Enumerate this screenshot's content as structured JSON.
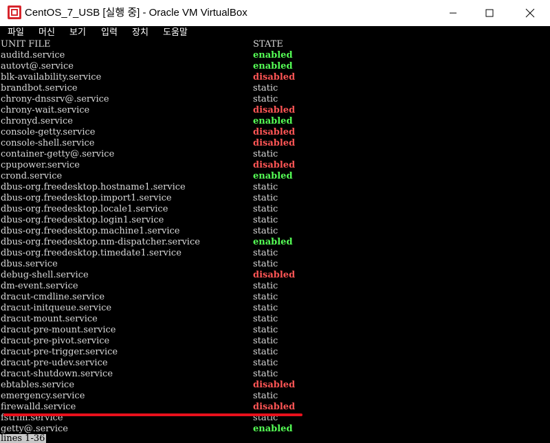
{
  "window": {
    "title": "CentOS_7_USB [실행 중] - Oracle VM VirtualBox"
  },
  "menu": [
    "파일",
    "머신",
    "보기",
    "입력",
    "장치",
    "도움말"
  ],
  "console": {
    "headers": {
      "unit": "UNIT FILE",
      "state": "STATE"
    },
    "rows": [
      {
        "unit": "auditd.service",
        "state": "enabled"
      },
      {
        "unit": "autovt@.service",
        "state": "enabled"
      },
      {
        "unit": "blk-availability.service",
        "state": "disabled"
      },
      {
        "unit": "brandbot.service",
        "state": "static"
      },
      {
        "unit": "chrony-dnssrv@.service",
        "state": "static"
      },
      {
        "unit": "chrony-wait.service",
        "state": "disabled"
      },
      {
        "unit": "chronyd.service",
        "state": "enabled"
      },
      {
        "unit": "console-getty.service",
        "state": "disabled"
      },
      {
        "unit": "console-shell.service",
        "state": "disabled"
      },
      {
        "unit": "container-getty@.service",
        "state": "static"
      },
      {
        "unit": "cpupower.service",
        "state": "disabled"
      },
      {
        "unit": "crond.service",
        "state": "enabled"
      },
      {
        "unit": "dbus-org.freedesktop.hostname1.service",
        "state": "static"
      },
      {
        "unit": "dbus-org.freedesktop.import1.service",
        "state": "static"
      },
      {
        "unit": "dbus-org.freedesktop.locale1.service",
        "state": "static"
      },
      {
        "unit": "dbus-org.freedesktop.login1.service",
        "state": "static"
      },
      {
        "unit": "dbus-org.freedesktop.machine1.service",
        "state": "static"
      },
      {
        "unit": "dbus-org.freedesktop.nm-dispatcher.service",
        "state": "enabled"
      },
      {
        "unit": "dbus-org.freedesktop.timedate1.service",
        "state": "static"
      },
      {
        "unit": "dbus.service",
        "state": "static"
      },
      {
        "unit": "debug-shell.service",
        "state": "disabled"
      },
      {
        "unit": "dm-event.service",
        "state": "static"
      },
      {
        "unit": "dracut-cmdline.service",
        "state": "static"
      },
      {
        "unit": "dracut-initqueue.service",
        "state": "static"
      },
      {
        "unit": "dracut-mount.service",
        "state": "static"
      },
      {
        "unit": "dracut-pre-mount.service",
        "state": "static"
      },
      {
        "unit": "dracut-pre-pivot.service",
        "state": "static"
      },
      {
        "unit": "dracut-pre-trigger.service",
        "state": "static"
      },
      {
        "unit": "dracut-pre-udev.service",
        "state": "static"
      },
      {
        "unit": "dracut-shutdown.service",
        "state": "static"
      },
      {
        "unit": "ebtables.service",
        "state": "disabled"
      },
      {
        "unit": "emergency.service",
        "state": "static"
      },
      {
        "unit": "firewalld.service",
        "state": "disabled"
      },
      {
        "unit": "fstrim.service",
        "state": "static"
      },
      {
        "unit": "getty@.service",
        "state": "enabled"
      }
    ],
    "pager": "lines 1-36"
  }
}
